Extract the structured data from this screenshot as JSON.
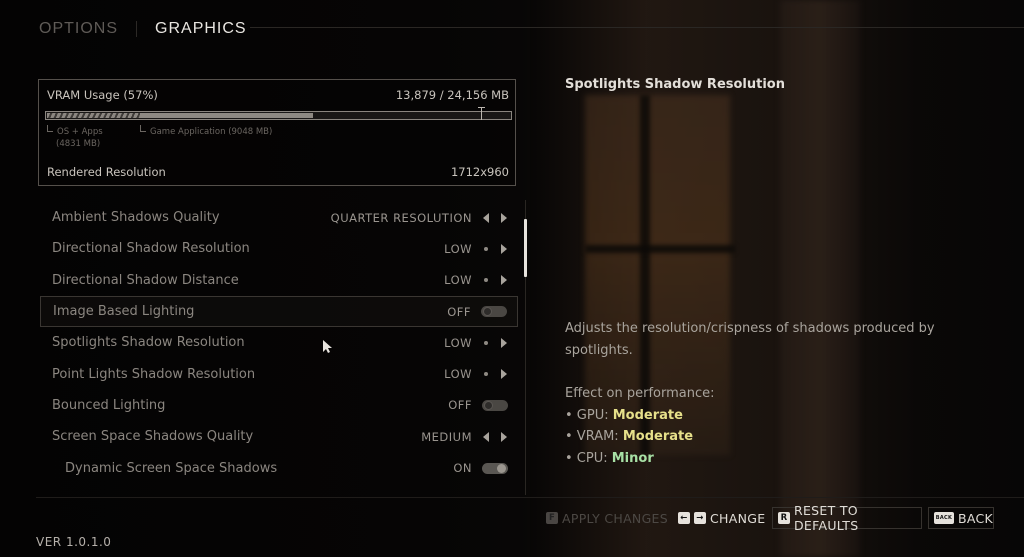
{
  "tabs": [
    {
      "label": "OPTIONS",
      "active": false
    },
    {
      "label": "GRAPHICS",
      "active": true
    }
  ],
  "vram": {
    "title": "VRAM Usage (57%)",
    "usage_text": "13,879 / 24,156 MB",
    "used_mb": 13879,
    "total_mb": 24156,
    "os_mb": 4831,
    "game_mb": 9048,
    "os_label": "OS + Apps",
    "os_amount": "(4831 MB)",
    "game_label": "Game Application (9048 MB)",
    "limit_marker_fraction": 0.94,
    "rendered_resolution_label": "Rendered Resolution",
    "rendered_resolution_value": "1712x960"
  },
  "settings": [
    {
      "label": "Ambient Shadows Quality",
      "value": "QUARTER RESOLUTION",
      "control": "arrows",
      "left": "arrow",
      "selected": false,
      "indent": false
    },
    {
      "label": "Directional Shadow Resolution",
      "value": "LOW",
      "control": "arrows",
      "left": "dot",
      "selected": false,
      "indent": false
    },
    {
      "label": "Directional Shadow Distance",
      "value": "LOW",
      "control": "arrows",
      "left": "dot",
      "selected": false,
      "indent": false
    },
    {
      "label": "Image Based Lighting",
      "value": "OFF",
      "control": "toggle",
      "on": false,
      "selected": true,
      "indent": false
    },
    {
      "label": "Spotlights Shadow Resolution",
      "value": "LOW",
      "control": "arrows",
      "left": "dot",
      "selected": false,
      "indent": false
    },
    {
      "label": "Point Lights Shadow Resolution",
      "value": "LOW",
      "control": "arrows",
      "left": "dot",
      "selected": false,
      "indent": false
    },
    {
      "label": "Bounced Lighting",
      "value": "OFF",
      "control": "toggle",
      "on": false,
      "selected": false,
      "indent": false
    },
    {
      "label": "Screen Space Shadows Quality",
      "value": "MEDIUM",
      "control": "arrows",
      "left": "arrow",
      "selected": false,
      "indent": false
    },
    {
      "label": "Dynamic Screen Space Shadows",
      "value": "ON",
      "control": "toggle",
      "on": true,
      "selected": false,
      "indent": true
    }
  ],
  "description": {
    "title": "Spotlights Shadow Resolution",
    "text": "Adjusts the resolution/crispness of shadows produced by spotlights.",
    "perf_heading": "Effect on performance:",
    "perf": [
      {
        "bullet": "• GPU: ",
        "level": "Moderate",
        "kind": "moderate"
      },
      {
        "bullet": "• VRAM: ",
        "level": "Moderate",
        "kind": "moderate"
      },
      {
        "bullet": "• CPU: ",
        "level": "Minor",
        "kind": "minor"
      }
    ],
    "colors": {
      "moderate": "#e6e08a",
      "minor": "#a7e0a5"
    }
  },
  "footer": {
    "version": "VER 1.0.1.0",
    "apply": {
      "key": "F",
      "label": "APPLY CHANGES"
    },
    "change": {
      "key_left": "←",
      "key_right": "→",
      "label": "CHANGE"
    },
    "reset": {
      "key": "R",
      "label": "RESET TO DEFAULTS"
    },
    "back": {
      "key": "BACK",
      "label": "BACK"
    }
  }
}
